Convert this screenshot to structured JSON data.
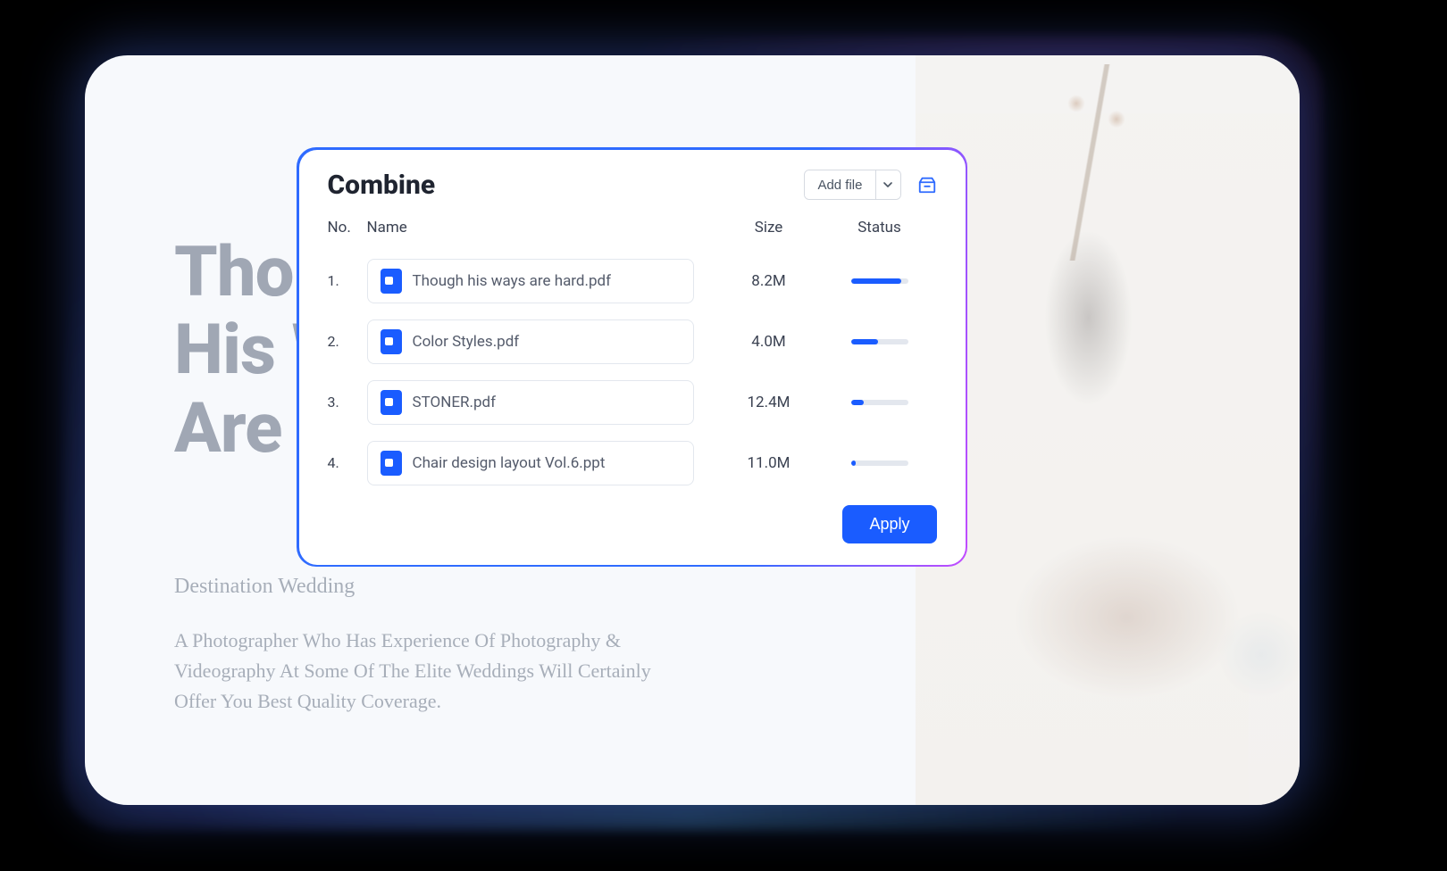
{
  "background": {
    "heading_line1": "Though",
    "heading_line2": "His Ways",
    "heading_line3": "Are Hard",
    "subheading": "Destination Wedding",
    "body": "A Photographer Who Has Experience Of Photography & Videography At Some Of The Elite Weddings Will Certainly Offer You Best Quality Coverage."
  },
  "dialog": {
    "title": "Combine",
    "add_file_label": "Add file",
    "columns": {
      "no": "No.",
      "name": "Name",
      "size": "Size",
      "status": "Status"
    },
    "files": [
      {
        "index": "1.",
        "name": "Though his ways are hard.pdf",
        "size": "8.2M",
        "progress": 88
      },
      {
        "index": "2.",
        "name": "Color Styles.pdf",
        "size": "4.0M",
        "progress": 48
      },
      {
        "index": "3.",
        "name": "STONER.pdf",
        "size": "12.4M",
        "progress": 22
      },
      {
        "index": "4.",
        "name": "Chair design layout Vol.6.ppt",
        "size": "11.0M",
        "progress": 8
      }
    ],
    "apply_label": "Apply"
  }
}
